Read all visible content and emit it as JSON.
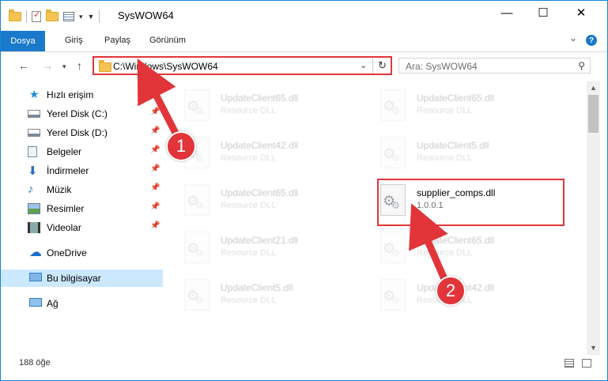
{
  "window": {
    "title": "SysWOW64",
    "controls": {
      "minimize": "—",
      "maximize": "☐",
      "close": "✕"
    }
  },
  "ribbon": {
    "tabs": [
      "Dosya",
      "Giriş",
      "Paylaş",
      "Görünüm"
    ],
    "expand_icon": "⌄",
    "help_icon": "?"
  },
  "address": {
    "path": "C:\\Windows\\SysWOW64",
    "search_placeholder": "Ara: SysWOW64"
  },
  "nav": {
    "quick_access": "Hızlı erişim",
    "items": [
      {
        "label": "Yerel Disk (C:)",
        "icon": "drive-icon"
      },
      {
        "label": "Yerel Disk (D:)",
        "icon": "drive-icon"
      },
      {
        "label": "Belgeler",
        "icon": "documents-icon"
      },
      {
        "label": "İndirmeler",
        "icon": "downloads-icon"
      },
      {
        "label": "Müzik",
        "icon": "music-icon"
      },
      {
        "label": "Resimler",
        "icon": "pictures-icon"
      },
      {
        "label": "Videolar",
        "icon": "videos-icon"
      }
    ],
    "onedrive": "OneDrive",
    "this_pc": "Bu bilgisayar",
    "network": "Ağ"
  },
  "files": {
    "left": [
      {
        "name": "UpdateClient65.dll",
        "type": "Resource DLL"
      },
      {
        "name": "UpdateClient42.dll",
        "type": "Resource DLL"
      },
      {
        "name": "UpdateClient65.dll",
        "type": "Resource DLL"
      },
      {
        "name": "UpdateClient21.dll",
        "type": "Resource DLL"
      },
      {
        "name": "UpdateClient5.dll",
        "type": "Resource DLL"
      }
    ],
    "right": [
      {
        "name": "UpdateClient65.dll",
        "type": "Resource DLL"
      },
      {
        "name": "UpdateClient5.dll",
        "type": "Resource DLL"
      },
      {
        "name": "supplier_comps.dll",
        "type": "1.0.0.1"
      },
      {
        "name": "UpdateClient65.dll",
        "type": "Resource DLL"
      },
      {
        "name": "UpdateClient42.dll",
        "type": "Resource DLL"
      }
    ]
  },
  "status": {
    "count": "188 öğe"
  },
  "annotations": {
    "step1": "1",
    "step2": "2",
    "color": "#e2353a"
  }
}
